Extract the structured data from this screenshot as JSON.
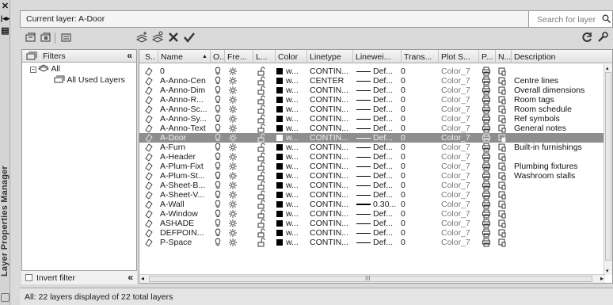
{
  "palette": {
    "selected_row": "#8e8e8e",
    "bg": "#dadada",
    "panel": "#ffffff"
  },
  "side": {
    "title": "Layer Properties Manager",
    "close_icon": "close-icon",
    "pin_icon": "autohide-icon",
    "menu_icon": "properties-icon"
  },
  "top": {
    "current_layer": "Current layer: A-Door",
    "search_placeholder": "Search for layer"
  },
  "filters": {
    "header": "Filters",
    "collapse": "«",
    "tree": [
      "All",
      "All Used Layers"
    ],
    "invert": "Invert filter",
    "invert_collapse": "«"
  },
  "columns": [
    "S..",
    "Name",
    "O..",
    "Fre...",
    "L...",
    "Color",
    "Linetype",
    "Linewei...",
    "Trans...",
    "Plot S...",
    "P...",
    "N...",
    "Description"
  ],
  "rows": [
    {
      "name": "0",
      "color": "w...",
      "linetype": "CONTIN...",
      "lw": "Def...",
      "trans": "0",
      "plot": "Color_7",
      "desc": ""
    },
    {
      "name": "A-Anno-Cen",
      "color": "w...",
      "linetype": "CENTER",
      "lw": "Def...",
      "trans": "0",
      "plot": "Color_7",
      "desc": "Centre lines"
    },
    {
      "name": "A-Anno-Dim",
      "color": "w...",
      "linetype": "CONTIN...",
      "lw": "Def...",
      "trans": "0",
      "plot": "Color_7",
      "desc": "Overall dimensions"
    },
    {
      "name": "A-Anno-R...",
      "color": "w...",
      "linetype": "CONTIN...",
      "lw": "Def...",
      "trans": "0",
      "plot": "Color_7",
      "desc": "Room tags"
    },
    {
      "name": "A-Anno-Sc...",
      "color": "w...",
      "linetype": "CONTIN...",
      "lw": "Def...",
      "trans": "0",
      "plot": "Color_7",
      "desc": "Room schedule"
    },
    {
      "name": "A-Anno-Sy...",
      "color": "w...",
      "linetype": "CONTIN...",
      "lw": "Def...",
      "trans": "0",
      "plot": "Color_7",
      "desc": "Ref symbols"
    },
    {
      "name": "A-Anno-Text",
      "color": "w...",
      "linetype": "CONTIN...",
      "lw": "Def...",
      "trans": "0",
      "plot": "Color_7",
      "desc": "General notes"
    },
    {
      "name": "A-Door",
      "color": "w...",
      "linetype": "CONTIN...",
      "lw": "Def...",
      "trans": "0",
      "plot": "Color_7",
      "desc": "",
      "selected": true
    },
    {
      "name": "A-Furn",
      "color": "w...",
      "linetype": "CONTIN...",
      "lw": "Def...",
      "trans": "0",
      "plot": "Color_7",
      "desc": "Built-in furnishings"
    },
    {
      "name": "A-Header",
      "color": "w...",
      "linetype": "CONTIN...",
      "lw": "Def...",
      "trans": "0",
      "plot": "Color_7",
      "desc": ""
    },
    {
      "name": "A-Plum-Fixt",
      "color": "w...",
      "linetype": "CONTIN...",
      "lw": "Def...",
      "trans": "0",
      "plot": "Color_7",
      "desc": "Plumbing fixtures"
    },
    {
      "name": "A-Plum-St...",
      "color": "w...",
      "linetype": "CONTIN...",
      "lw": "Def...",
      "trans": "0",
      "plot": "Color_7",
      "desc": "Washroom stalls"
    },
    {
      "name": "A-Sheet-B...",
      "color": "w...",
      "linetype": "CONTIN...",
      "lw": "Def...",
      "trans": "0",
      "plot": "Color_7",
      "desc": ""
    },
    {
      "name": "A-Sheet-V...",
      "color": "w...",
      "linetype": "CONTIN...",
      "lw": "Def...",
      "trans": "0",
      "plot": "Color_7",
      "desc": ""
    },
    {
      "name": "A-Wall",
      "color": "w...",
      "linetype": "CONTIN...",
      "lw": "0.30...",
      "trans": "0",
      "plot": "Color_7",
      "desc": ""
    },
    {
      "name": "A-Window",
      "color": "w...",
      "linetype": "CONTIN...",
      "lw": "Def...",
      "trans": "0",
      "plot": "Color_7",
      "desc": ""
    },
    {
      "name": "ASHADE",
      "color": "w...",
      "linetype": "CONTIN...",
      "lw": "Def...",
      "trans": "0",
      "plot": "Color_7",
      "desc": ""
    },
    {
      "name": "DEFPOIN...",
      "color": "w...",
      "linetype": "CONTIN...",
      "lw": "Def...",
      "trans": "0",
      "plot": "Color_7",
      "desc": ""
    },
    {
      "name": "P-Space",
      "color": "w...",
      "linetype": "CONTIN...",
      "lw": "Def...",
      "trans": "0",
      "plot": "Color_7",
      "desc": ""
    }
  ],
  "hscroll_label": "III",
  "status": "All: 22 layers displayed of 22 total layers"
}
